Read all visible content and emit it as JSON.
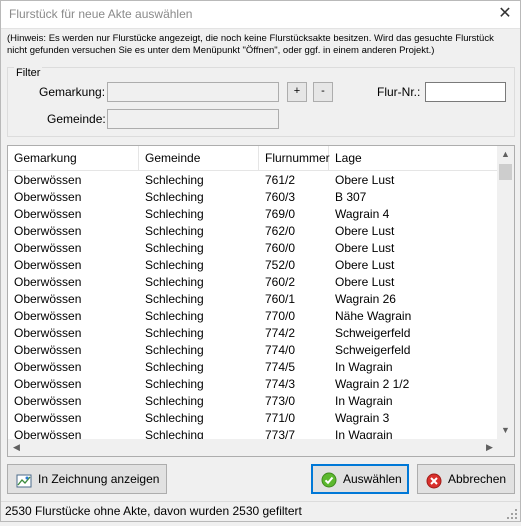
{
  "window": {
    "title": "Flurstück für neue Akte auswählen",
    "close_glyph": "✕"
  },
  "hint": {
    "text": "(Hinweis: Es werden nur Flurstücke angezeigt, die noch keine Flurstücksakte besitzen. Wird das gesuchte Flurstück nicht gefunden versuchen Sie es unter dem Menüpunkt \"Öffnen\", oder ggf. in einem anderen Projekt.)"
  },
  "filter": {
    "legend": "Filter",
    "gemarkung_label": "Gemarkung:",
    "gemarkung_value": "",
    "plus_label": "+",
    "minus_label": "-",
    "flurnr_label": "Flur-Nr.:",
    "flurnr_value": "",
    "gemeinde_label": "Gemeinde:",
    "gemeinde_value": ""
  },
  "table": {
    "columns": [
      "Gemarkung",
      "Gemeinde",
      "Flurnummer",
      "Lage"
    ],
    "rows": [
      [
        "Oberwössen",
        "Schleching",
        "761/2",
        "Obere Lust"
      ],
      [
        "Oberwössen",
        "Schleching",
        "760/3",
        "B 307"
      ],
      [
        "Oberwössen",
        "Schleching",
        "769/0",
        "Wagrain 4"
      ],
      [
        "Oberwössen",
        "Schleching",
        "762/0",
        "Obere Lust"
      ],
      [
        "Oberwössen",
        "Schleching",
        "760/0",
        "Obere Lust"
      ],
      [
        "Oberwössen",
        "Schleching",
        "752/0",
        "Obere Lust"
      ],
      [
        "Oberwössen",
        "Schleching",
        "760/2",
        "Obere Lust"
      ],
      [
        "Oberwössen",
        "Schleching",
        "760/1",
        "Wagrain 26"
      ],
      [
        "Oberwössen",
        "Schleching",
        "770/0",
        "Nähe Wagrain"
      ],
      [
        "Oberwössen",
        "Schleching",
        "774/2",
        "Schweigerfeld"
      ],
      [
        "Oberwössen",
        "Schleching",
        "774/0",
        "Schweigerfeld"
      ],
      [
        "Oberwössen",
        "Schleching",
        "774/5",
        "In Wagrain"
      ],
      [
        "Oberwössen",
        "Schleching",
        "774/3",
        "Wagrain 2 1/2"
      ],
      [
        "Oberwössen",
        "Schleching",
        "773/0",
        "In Wagrain"
      ],
      [
        "Oberwössen",
        "Schleching",
        "771/0",
        "Wagrain 3"
      ],
      [
        "Oberwössen",
        "Schleching",
        "773/7",
        "In Wagrain"
      ]
    ],
    "scroll_up_glyph": "▲",
    "scroll_down_glyph": "▼",
    "scroll_left_glyph": "◀",
    "scroll_right_glyph": "▶"
  },
  "buttons": {
    "show_in_drawing": "In Zeichnung anzeigen",
    "select": "Auswählen",
    "cancel": "Abbrechen"
  },
  "status": {
    "text": "2530 Flurstücke ohne Akte, davon wurden 2530 gefiltert"
  },
  "colors": {
    "primary_border": "#0078d7",
    "select_icon": "#5cb82e",
    "cancel_icon": "#d9302c"
  }
}
